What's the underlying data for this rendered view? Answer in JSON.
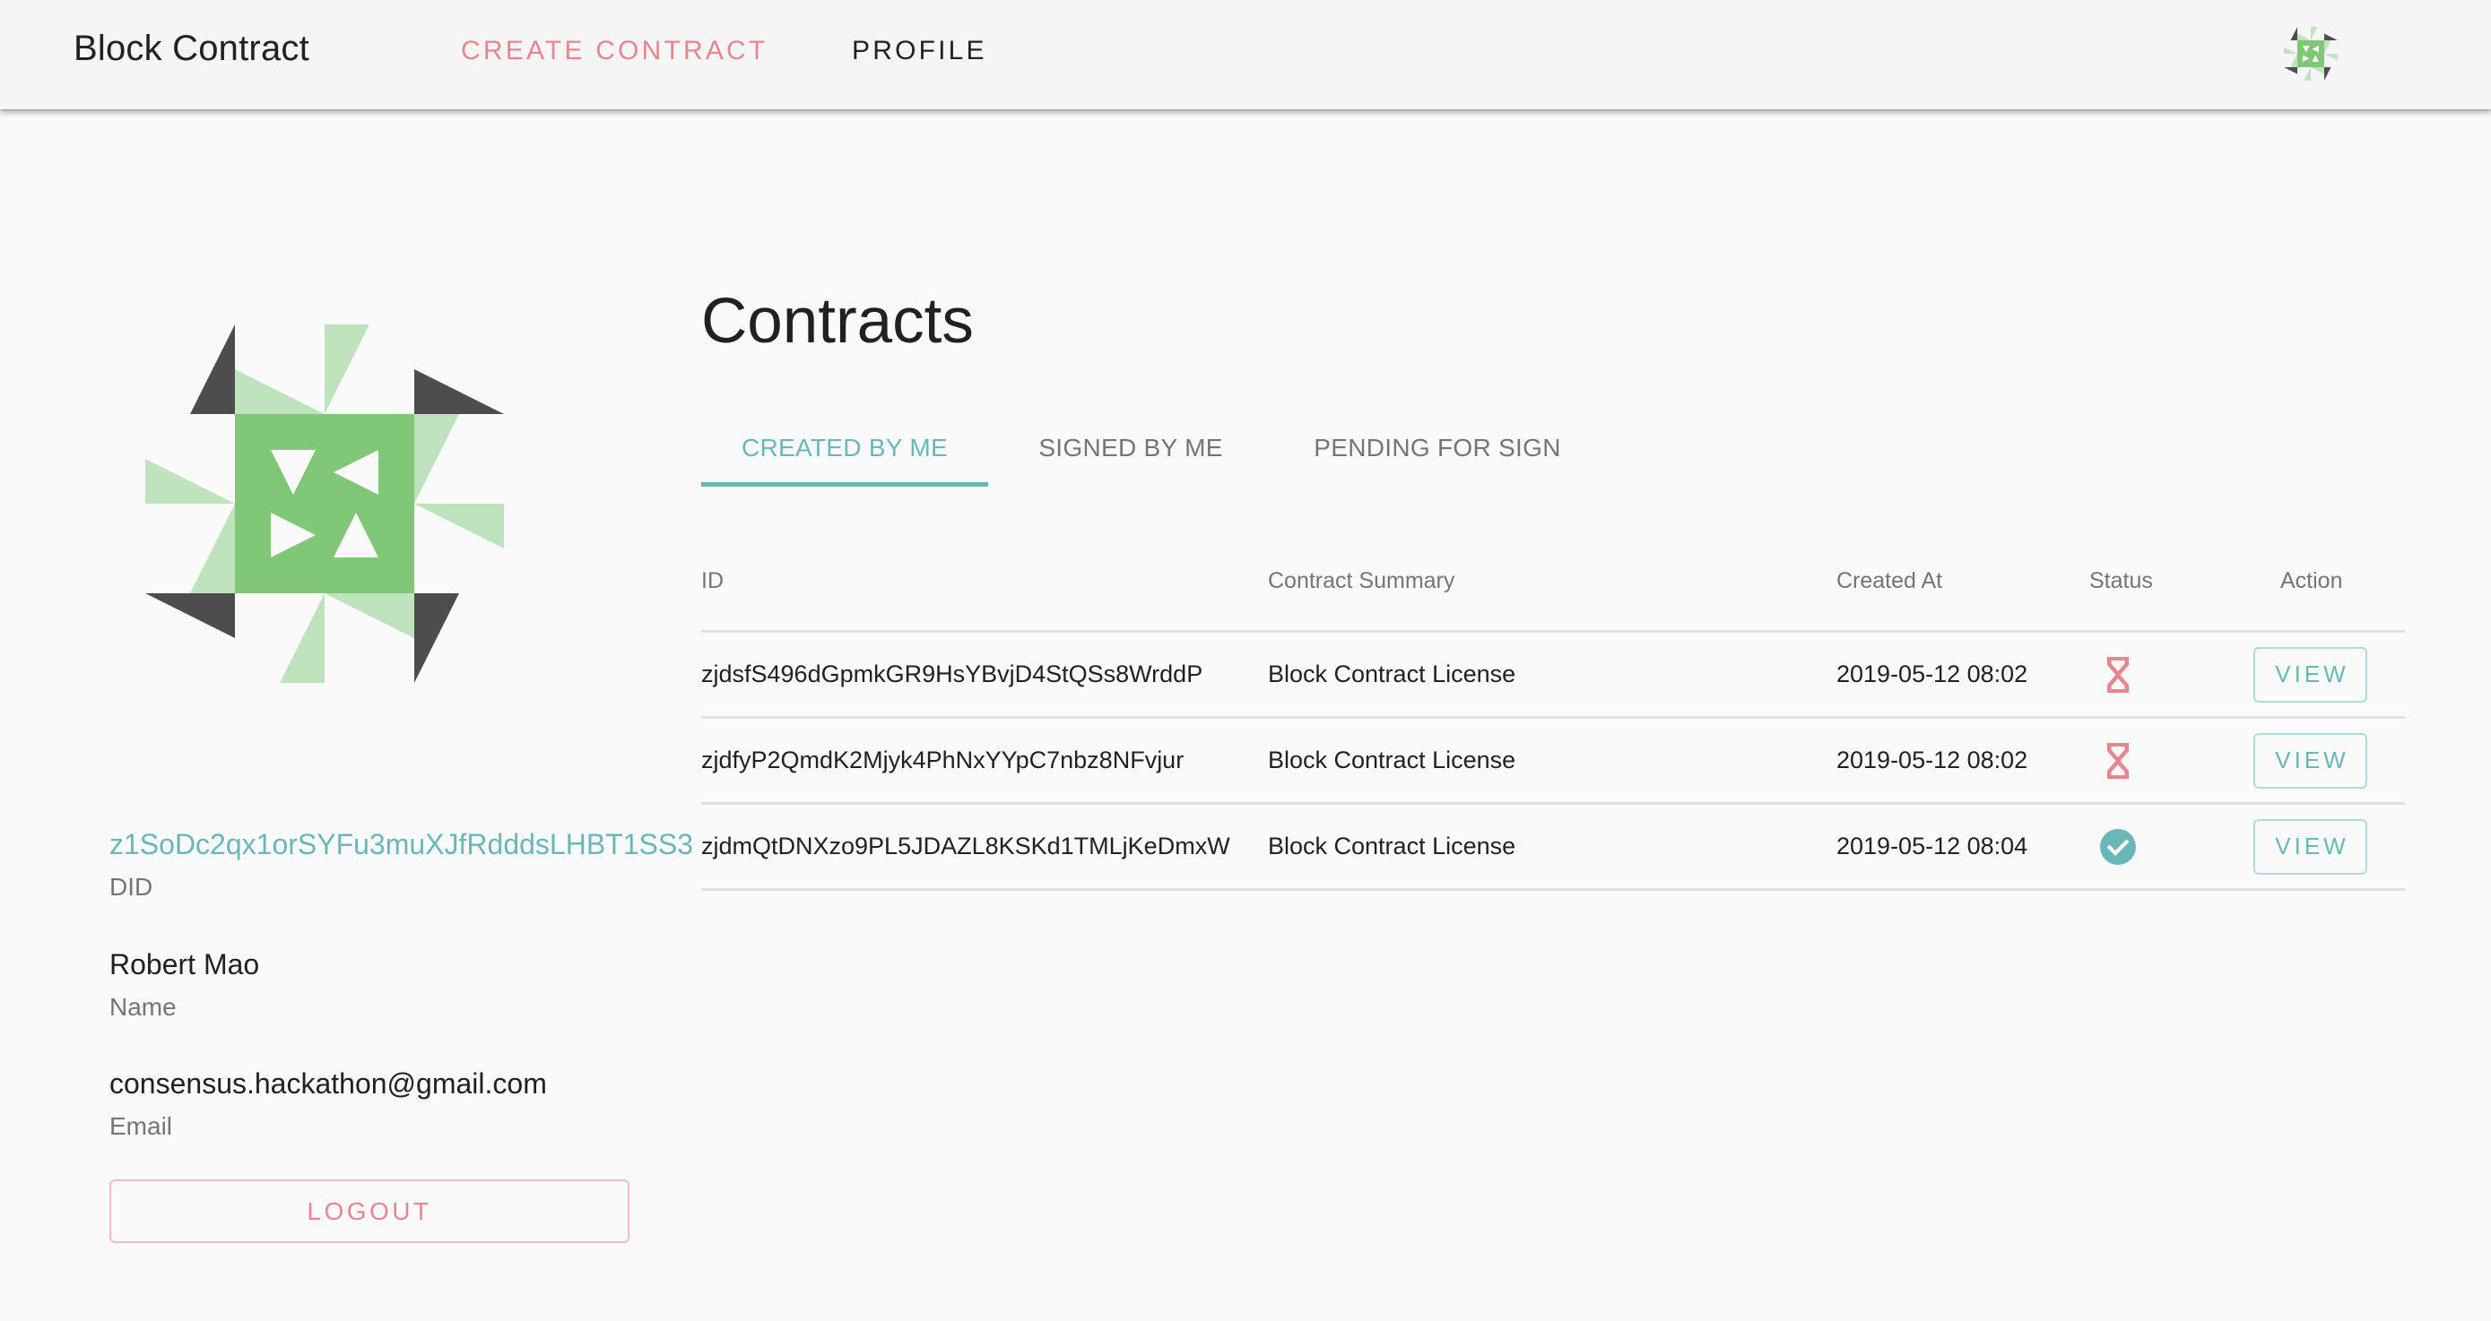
{
  "appbar": {
    "title": "Block Contract",
    "nav": [
      {
        "label": "CREATE CONTRACT",
        "active": true
      },
      {
        "label": "PROFILE",
        "active": false
      }
    ],
    "avatar_icon": "identicon-avatar"
  },
  "profile": {
    "avatar_icon": "identicon-avatar",
    "did": {
      "value": "z1SoDc2qx1orSYFu3muXJfRdddsLHBT1SS3",
      "label": "DID"
    },
    "name": {
      "value": "Robert Mao",
      "label": "Name"
    },
    "email": {
      "value": "consensus.hackathon@gmail.com",
      "label": "Email"
    },
    "logout_label": "LOGOUT"
  },
  "contracts": {
    "title": "Contracts",
    "tabs": [
      {
        "label": "CREATED BY ME",
        "active": true
      },
      {
        "label": "SIGNED BY ME",
        "active": false
      },
      {
        "label": "PENDING FOR SIGN",
        "active": false
      }
    ],
    "columns": {
      "id": "ID",
      "summary": "Contract Summary",
      "created_at": "Created At",
      "status": "Status",
      "action": "Action"
    },
    "rows": [
      {
        "id": "zjdsfS496dGpmkGR9HsYBvjD4StQSs8WrddP",
        "summary": "Block Contract License",
        "created_at": "2019-05-12 08:02",
        "status": "pending",
        "status_icon": "hourglass-icon",
        "action_label": "VIEW"
      },
      {
        "id": "zjdfyP2QmdK2Mjyk4PhNxYYpC7nbz8NFvjur",
        "summary": "Block Contract License",
        "created_at": "2019-05-12 08:02",
        "status": "pending",
        "status_icon": "hourglass-icon",
        "action_label": "VIEW"
      },
      {
        "id": "zjdmQtDNXzo9PL5JDAZL8KSKd1TMLjKeDmxW",
        "summary": "Block Contract License",
        "created_at": "2019-05-12 08:04",
        "status": "signed",
        "status_icon": "check-circle-icon",
        "action_label": "VIEW"
      }
    ]
  },
  "colors": {
    "accent_teal": "#6ab7b8",
    "accent_pink": "#e8868f",
    "identicon_green": "#80c878",
    "identicon_light_green": "#bfe3bc",
    "identicon_dark": "#4d4d4d"
  }
}
